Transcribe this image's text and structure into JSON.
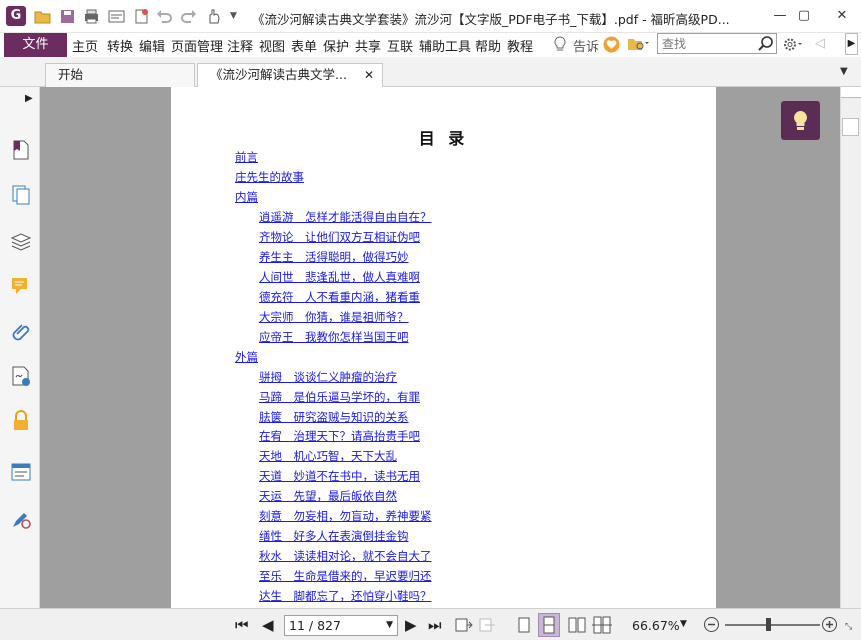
{
  "window": {
    "title": "《流沙河解读古典文学套装》流沙河【文字版_PDF电子书_下载】.pdf - 福昕高级PD...",
    "app_icon_letter": "G",
    "controls": {
      "minimize": "—",
      "restore": "▢",
      "close": "✕"
    }
  },
  "menubar": {
    "file": "文件",
    "items": [
      "主页",
      "转换",
      "编辑",
      "页面管理",
      "注释",
      "视图",
      "表单",
      "保护",
      "共享",
      "互联",
      "辅助工具",
      "帮助",
      "教程"
    ],
    "tell_me": "告诉",
    "search_placeholder": "查找"
  },
  "tabs": [
    {
      "label": "开始"
    },
    {
      "label": "《流沙河解读古典文学..."
    }
  ],
  "document": {
    "toc_title": "目 录",
    "top_level": [
      {
        "label": "前言"
      },
      {
        "label": "庄先生的故事"
      },
      {
        "label": "内篇"
      },
      {
        "label": "外篇"
      }
    ],
    "inner_chapters": [
      "逍遥游　怎样才能活得自由自在？",
      "齐物论　让他们双方互相证伪吧",
      "养生主　活得聪明，做得巧妙",
      "人间世　悲逢乱世，做人真难啊",
      "德充符　人不看重内涵，猪看重",
      "大宗师　你猜，谁是祖师爷？",
      "应帝王　我教你怎样当国王吧"
    ],
    "outer_chapters": [
      "骈拇　谈谈仁义肿瘤的治疗",
      "马蹄　是伯乐逼马学坏的，有罪",
      "胠箧　研究盗贼与知识的关系",
      "在宥　治理天下？请高抬贵手吧",
      "天地　机心巧智，天下大乱",
      "天道　妙道不在书中，读书无用",
      "天运　先望，最后皈依自然",
      "刻意　勿妄相，勿盲动，养神要紧",
      "缮性　好多人在表演倒挂金钩",
      "秋水　读读相对论，就不会自大了",
      "至乐　生命是借来的，早迟要归还",
      "达生　脚都忘了，还怕穿小鞋吗？"
    ]
  },
  "statusbar": {
    "page_indicator": "11 / 827",
    "zoom": "66.67%",
    "zoom_slider_fraction": 0.45
  },
  "colors": {
    "brand": "#6b2d5f",
    "link": "#1a1ae6",
    "viewer_bg": "#9f9f9f"
  }
}
